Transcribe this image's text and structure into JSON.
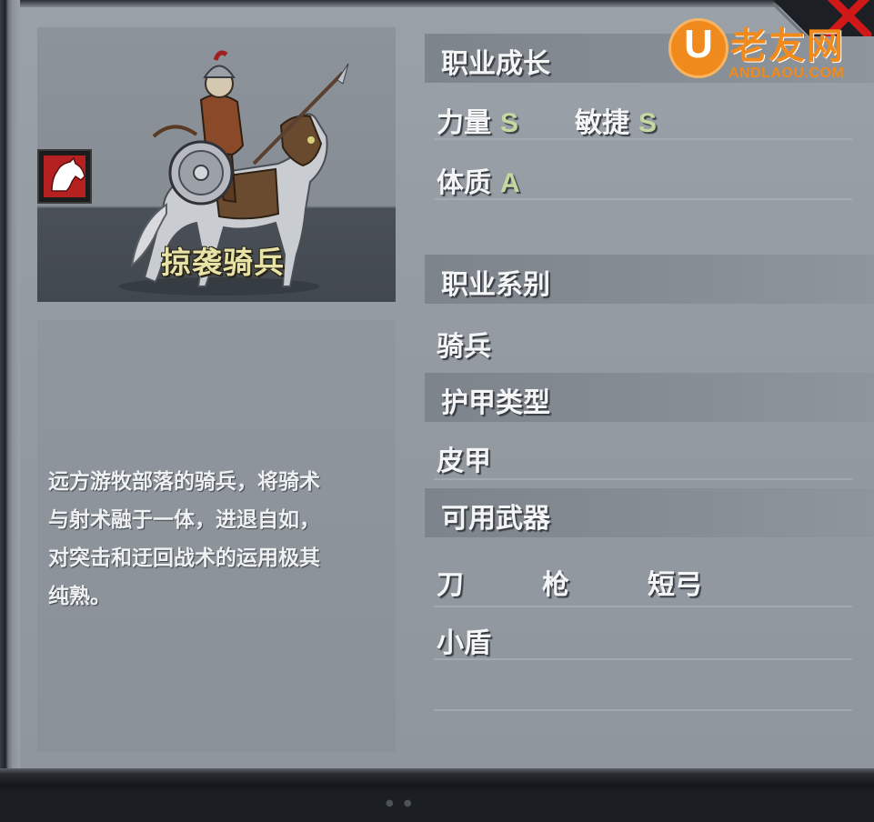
{
  "unit": {
    "name": "掠袭骑兵",
    "description_lines": [
      "远方游牧部落的骑兵，将骑术",
      "与射术融于一体，进退自如，",
      "对突击和迂回战术的运用极其",
      "纯熟。"
    ]
  },
  "growth": {
    "title": "职业成长",
    "strength_label": "力量",
    "strength_grade": "S",
    "agility_label": "敏捷",
    "agility_grade": "S",
    "constitution_label": "体质",
    "constitution_grade": "A"
  },
  "class_series": {
    "title": "职业系别",
    "value": "骑兵"
  },
  "armor_type": {
    "title": "护甲类型",
    "value": "皮甲"
  },
  "weapons": {
    "title": "可用武器",
    "items": [
      "刀",
      "枪",
      "短弓",
      "小盾"
    ]
  },
  "watermark": {
    "mark": "U",
    "name": "老友网",
    "url": "ANDLAOU.COM"
  },
  "colors": {
    "panel": "#949ba2",
    "grade": "#c6d8a0",
    "unit_name": "#e7e2a6",
    "badge": "#b52020",
    "close_x": "#d01818",
    "watermark": "#f08a1c"
  },
  "icons": {
    "class_badge": "horse-head-icon",
    "close": "close-x-icon"
  }
}
